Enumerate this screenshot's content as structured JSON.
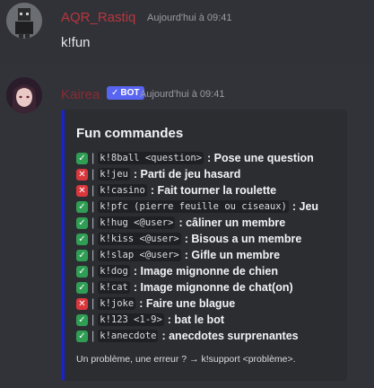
{
  "message1": {
    "username": "AQR_Rastiq",
    "timestamp": "Aujourd'hui à 09:41",
    "content": "k!fun"
  },
  "message2": {
    "username": "Kairea",
    "bot_badge": "BOT",
    "timestamp": "Aujourd'hui à 09:41",
    "embed": {
      "title": "Fun commandes",
      "accent_color": "#1a22c9",
      "commands": [
        {
          "status": "enabled",
          "cmd": "k!8ball <question>",
          "desc": ": Pose une question"
        },
        {
          "status": "disabled",
          "cmd": "k!jeu",
          "desc": ": Parti de jeu hasard"
        },
        {
          "status": "disabled",
          "cmd": "k!casino",
          "desc": ": Fait tourner la roulette"
        },
        {
          "status": "enabled",
          "cmd": "k!pfc (pierre feuille ou ciseaux)",
          "desc": ": Jeu"
        },
        {
          "status": "enabled",
          "cmd": "k!hug <@user>",
          "desc": ": câliner un membre"
        },
        {
          "status": "enabled",
          "cmd": "k!kiss <@user>",
          "desc": ": Bisous a un membre"
        },
        {
          "status": "enabled",
          "cmd": "k!slap <@user>",
          "desc": ": Gifle un membre"
        },
        {
          "status": "enabled",
          "cmd": "k!dog",
          "desc": ": Image mignonne de chien"
        },
        {
          "status": "enabled",
          "cmd": "k!cat",
          "desc": ": Image mignonne de chat(on)"
        },
        {
          "status": "disabled",
          "cmd": "k!joke",
          "desc": ": Faire une blague"
        },
        {
          "status": "enabled",
          "cmd": "k!123 <1-9>",
          "desc": ": bat le bot"
        },
        {
          "status": "enabled",
          "cmd": "k!anecdote",
          "desc": ": anecdotes surprenantes"
        }
      ],
      "footer": "Un problème, une erreur ? → k!support <problème>."
    }
  }
}
